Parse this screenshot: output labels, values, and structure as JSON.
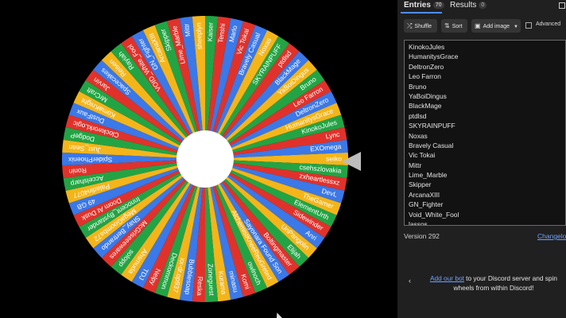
{
  "tabs": {
    "entries": {
      "label": "Entries",
      "count": "70"
    },
    "results": {
      "label": "Results",
      "count": "0"
    }
  },
  "toolbar": {
    "shuffle_label": "Shuffle",
    "sort_label": "Sort",
    "add_image_label": "Add image",
    "advanced_label": "Advanced"
  },
  "entries": [
    "KinokoJules",
    "HumanitysGrace",
    "DeltronZero",
    "Leo Farron",
    "Bruno",
    "YaBoiDingus",
    "BlackMage",
    "ptdlsd",
    "SKYRAINPUFF",
    "Noxas",
    "Bravely Casual",
    "Vic Tokai",
    "Mittr",
    "Lime_Marble",
    "Skipper",
    "ArcanaXIII",
    "GN_Fighter",
    "Void_White_Fool",
    "lassos"
  ],
  "footer": {
    "version": "Version 292",
    "changelog": "Changelog",
    "promo_link": "Add our bot",
    "promo_text": " to your Discord server and spin wheels from within Discord!"
  },
  "wheel": {
    "colors": [
      "#e0322b",
      "#3b78e8",
      "#f3b51a",
      "#23a444"
    ],
    "segments": [
      "Vic Tokai",
      "Bravely Casual",
      "Noxas",
      "SKYRAINPUFF",
      "ptdlsd",
      "BlackMage",
      "YaBoiDingus",
      "Bruno",
      "Leo Farron",
      "DeltronZero",
      "HumanitysGrace",
      "KinokoJules",
      "Lync",
      "EXOmega",
      "seiko",
      "csehszlovakia",
      "zxheartlessxz",
      "DevL",
      "TheGamer",
      "ElementUrth",
      "Sidewinder",
      "Anri",
      "UnPangolin",
      "Elijah",
      "Boltingmaster",
      "Sayonara Found Son",
      "AlchemistKneeReuGreted",
      "owlnoch",
      "Komi",
      "minasu",
      "Kurama",
      "Zoneguest",
      "Reska",
      "Bubblesoap",
      "xx-dr.op937",
      "Deckommon",
      "Nelpy",
      "TDJ",
      "Ahsmuda",
      "solopp",
      "McGriseeewares",
      "Shay_Bertrando",
      "MegaGoomba72",
      "Innocent_Bystander",
      "Doom At Dusk",
      "49 GB",
      "Paladin4077",
      "Accelsharp",
      "Ronin",
      "SpiderPhoenix",
      "Just_Sean",
      "DodgeP",
      "ClockworkLogic",
      "DustFaux",
      "KomaKnight",
      "MrCraft",
      "Jarvin",
      "Spacecakes",
      "Reisen",
      "Rayiah",
      "VOID_White_Fool",
      "GN_Fighter",
      "ArcanaXIII",
      "Skipper",
      "Lime_Marble",
      "Mittr",
      "sheeplyn",
      "Kaiser",
      "Tenshi",
      "Marlo"
    ]
  }
}
